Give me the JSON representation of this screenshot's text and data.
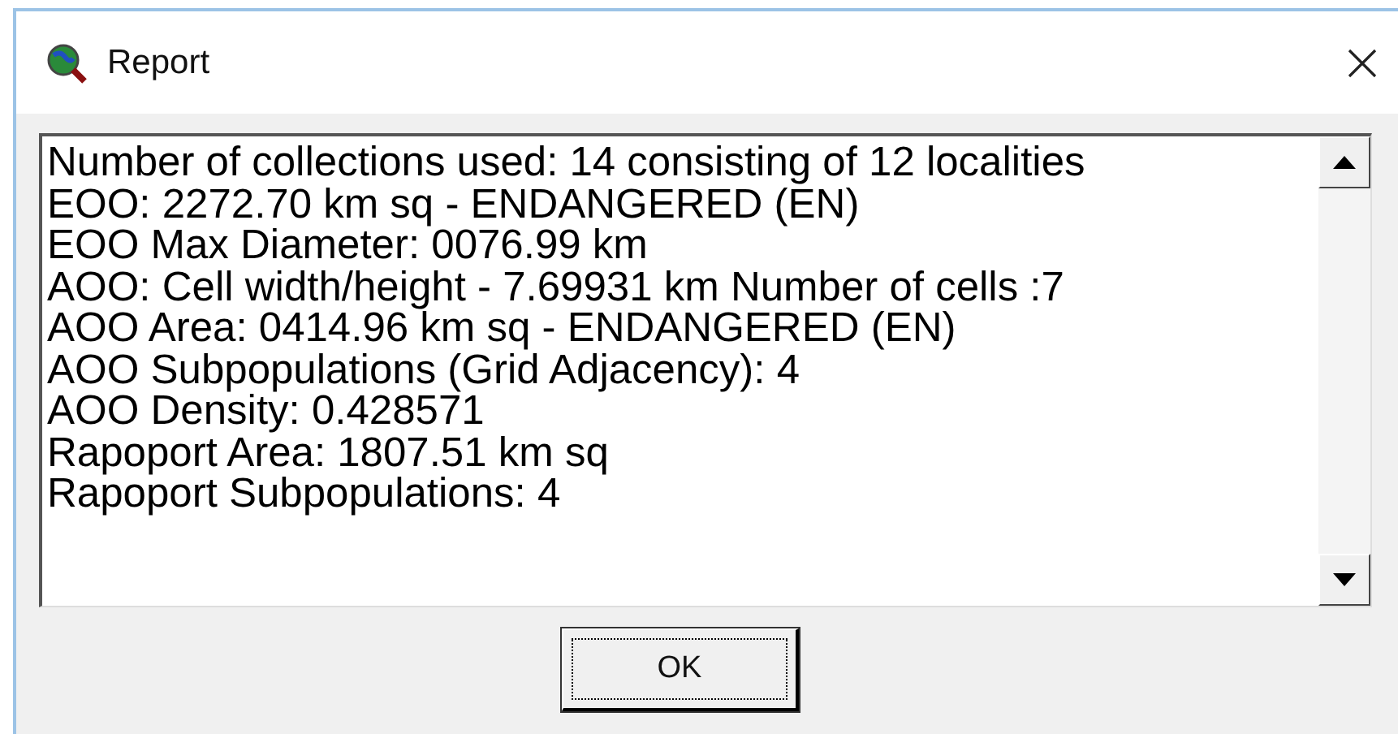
{
  "window": {
    "title": "Report"
  },
  "report": {
    "lines": [
      "Number of collections used: 14 consisting of 12 localities",
      "EOO: 2272.70 km sq - ENDANGERED (EN)",
      "EOO Max Diameter: 0076.99 km",
      "AOO: Cell width/height - 7.69931 km Number of cells :7",
      "AOO Area: 0414.96 km sq - ENDANGERED (EN)",
      "AOO Subpopulations (Grid Adjacency): 4",
      "AOO Density: 0.428571",
      "Rapoport Area: 1807.51 km sq",
      "Rapoport Subpopulations: 4"
    ]
  },
  "buttons": [
    {
      "label": "OK"
    }
  ]
}
